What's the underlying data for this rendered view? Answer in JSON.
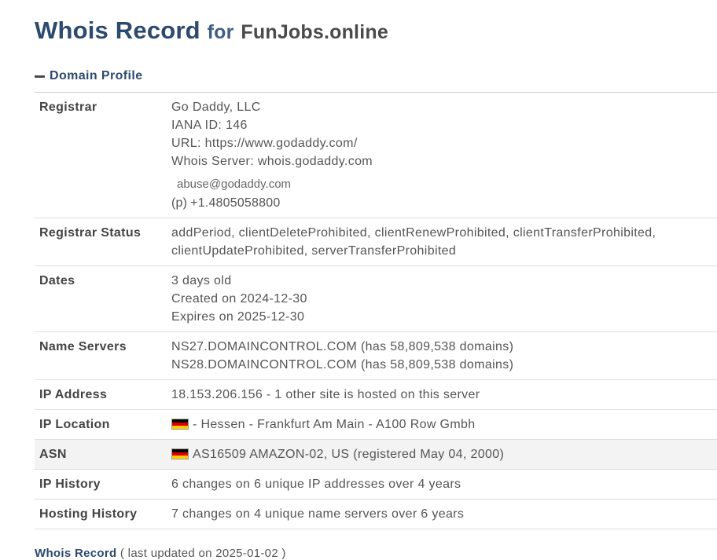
{
  "header": {
    "title": "Whois Record",
    "for_word": "for",
    "domain": "FunJobs.online"
  },
  "section": {
    "toggle_icon": "minus-icon",
    "title": "Domain Profile"
  },
  "registrar": {
    "label": "Registrar",
    "name": "Go Daddy, LLC",
    "iana": "IANA ID: 146",
    "url": "URL: https://www.godaddy.com/",
    "whois_server": "Whois Server: whois.godaddy.com",
    "email": "abuse@godaddy.com",
    "phone_prefix": "(p)",
    "phone": "+1.4805058800"
  },
  "status": {
    "label": "Registrar Status",
    "line1": "addPeriod, clientDeleteProhibited, clientRenewProhibited, clientTransferProhibited,",
    "line2": "clientUpdateProhibited, serverTransferProhibited"
  },
  "dates": {
    "label": "Dates",
    "age": "3 days old",
    "created": "Created on 2024-12-30",
    "expires": "Expires on 2025-12-30"
  },
  "name_servers": {
    "label": "Name Servers",
    "ns1": "NS27.DOMAINCONTROL.COM (has 58,809,538 domains)",
    "ns2": "NS28.DOMAINCONTROL.COM (has 58,809,538 domains)"
  },
  "ip_address": {
    "label": "IP Address",
    "value": "18.153.206.156 - 1 other site is hosted on this server"
  },
  "ip_location": {
    "label": "IP Location",
    "flag": "germany-flag-icon",
    "value": "- Hessen - Frankfurt Am Main - A100 Row Gmbh"
  },
  "asn": {
    "label": "ASN",
    "flag": "germany-flag-icon",
    "value": "AS16509 AMAZON-02, US (registered May 04, 2000)"
  },
  "ip_history": {
    "label": "IP History",
    "value": "6 changes on 6 unique IP addresses over 4 years"
  },
  "hosting_history": {
    "label": "Hosting History",
    "value": "7 changes on 4 unique name servers over 6 years"
  },
  "footer": {
    "title": "Whois Record",
    "note": " ( last updated on 2025-01-02 )"
  },
  "colors": {
    "heading": "#2c4a6e",
    "text": "#555555",
    "row_highlight": "#f3f3f3",
    "divider": "#dedede"
  }
}
